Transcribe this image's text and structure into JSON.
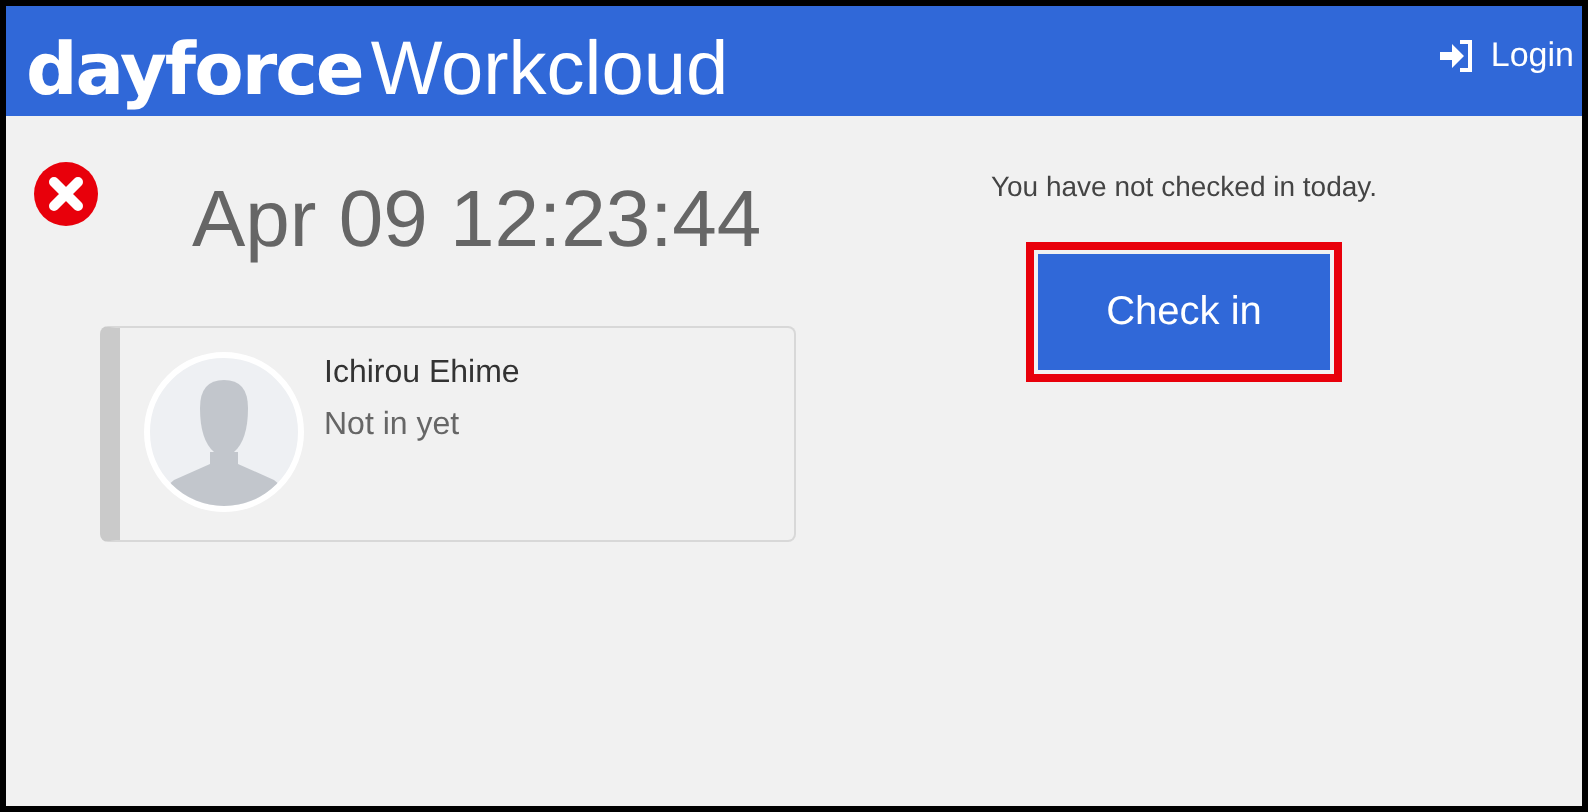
{
  "header": {
    "logo_bold": "dayforce",
    "logo_light": "Workcloud",
    "login": "Login"
  },
  "status": {
    "error": true,
    "datetime": "Apr 09 12:23:44"
  },
  "employee": {
    "name": "Ichirou Ehime",
    "status": "Not in yet"
  },
  "checkin": {
    "message": "You have not checked in today.",
    "button": "Check in",
    "highlighted": true
  }
}
